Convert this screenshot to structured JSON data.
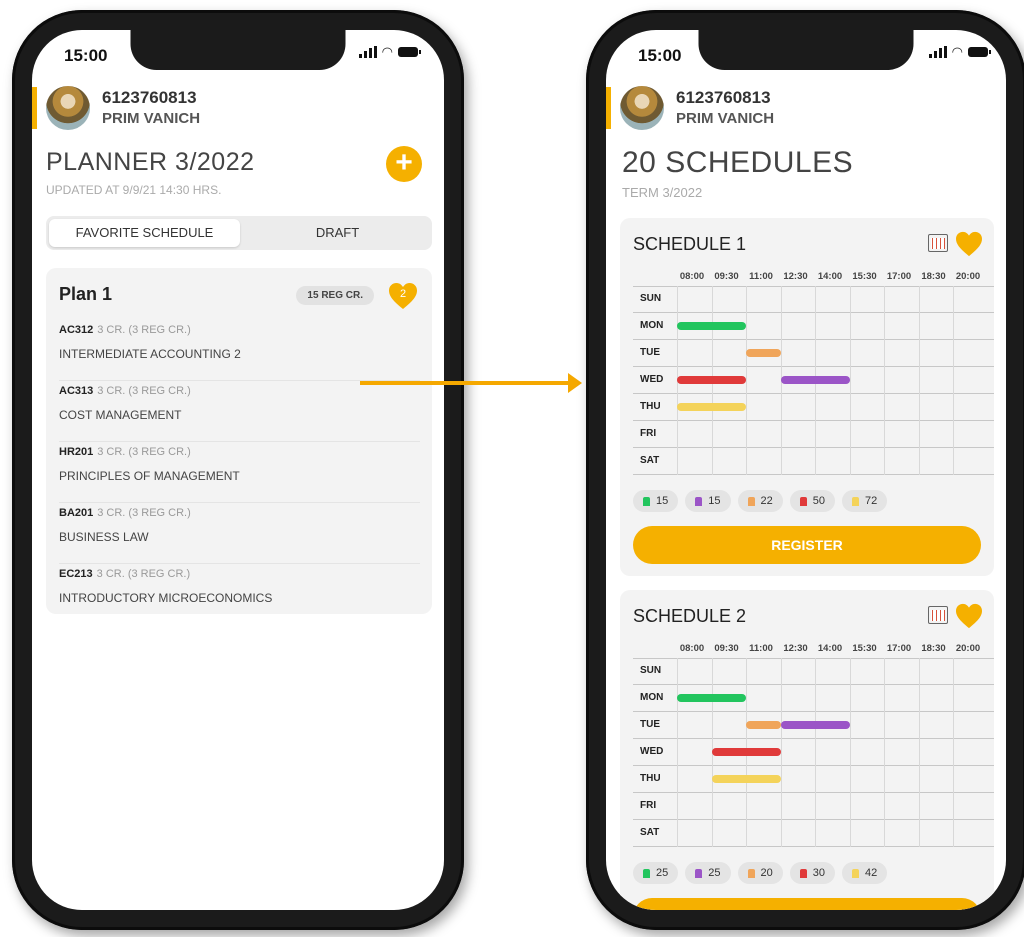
{
  "colors": {
    "accent": "#f5b000",
    "green": "#22c55e",
    "purple": "#9b55c7",
    "orange": "#f0a55a",
    "red": "#e03a3a",
    "yellow": "#f4d35a"
  },
  "left_phone": {
    "status": {
      "time": "15:00"
    },
    "profile": {
      "student_id": "6123760813",
      "name": "PRIM VANICH"
    },
    "title": "PLANNER 3/2022",
    "updated": "UPDATED AT 9/9/21 14:30 HRS.",
    "add_icon": "plus-icon",
    "tabs": {
      "favorite": "FAVORITE SCHEDULE",
      "draft": "DRAFT"
    },
    "plan": {
      "name": "Plan 1",
      "reg_credits": "15 REG CR.",
      "likes": "2",
      "courses": [
        {
          "code": "AC312",
          "credits": "3 CR. (3 REG CR.)",
          "name": "INTERMEDIATE ACCOUNTING 2"
        },
        {
          "code": "AC313",
          "credits": "3 CR. (3 REG CR.)",
          "name": "COST MANAGEMENT"
        },
        {
          "code": "HR201",
          "credits": "3 CR. (3 REG CR.)",
          "name": "PRINCIPLES OF MANAGEMENT"
        },
        {
          "code": "BA201",
          "credits": "3 CR. (3 REG CR.)",
          "name": "BUSINESS LAW"
        },
        {
          "code": "EC213",
          "credits": "3 CR. (3 REG CR.)",
          "name": "INTRODUCTORY MICROECONOMICS"
        }
      ]
    }
  },
  "right_phone": {
    "status": {
      "time": "15:00"
    },
    "profile": {
      "student_id": "6123760813",
      "name": "PRIM VANICH"
    },
    "title": "20 SCHEDULES",
    "term": "TERM 3/2022",
    "times": [
      "08:00",
      "09:30",
      "11:00",
      "12:30",
      "14:00",
      "15:30",
      "17:00",
      "18:30",
      "20:00"
    ],
    "days": [
      "SUN",
      "MON",
      "TUE",
      "WED",
      "THU",
      "FRI",
      "SAT"
    ],
    "schedules": [
      {
        "title": "SCHEDULE 1",
        "events": [
          {
            "day": "MON",
            "start": "08:00",
            "end": "11:00",
            "color": "#22c55e"
          },
          {
            "day": "TUE",
            "start": "11:00",
            "end": "12:30",
            "color": "#f0a55a"
          },
          {
            "day": "WED",
            "start": "08:00",
            "end": "11:00",
            "color": "#e03a3a"
          },
          {
            "day": "WED",
            "start": "12:30",
            "end": "15:30",
            "color": "#9b55c7"
          },
          {
            "day": "THU",
            "start": "08:00",
            "end": "11:00",
            "color": "#f4d35a"
          }
        ],
        "seats": [
          {
            "value": "15",
            "color": "#22c55e"
          },
          {
            "value": "15",
            "color": "#9b55c7"
          },
          {
            "value": "22",
            "color": "#f0a55a"
          },
          {
            "value": "50",
            "color": "#e03a3a"
          },
          {
            "value": "72",
            "color": "#f4d35a"
          }
        ],
        "register_label": "REGISTER"
      },
      {
        "title": "SCHEDULE 2",
        "events": [
          {
            "day": "MON",
            "start": "08:00",
            "end": "11:00",
            "color": "#22c55e"
          },
          {
            "day": "TUE",
            "start": "11:00",
            "end": "12:30",
            "color": "#f0a55a"
          },
          {
            "day": "TUE",
            "start": "12:30",
            "end": "15:30",
            "color": "#9b55c7"
          },
          {
            "day": "WED",
            "start": "09:30",
            "end": "12:30",
            "color": "#e03a3a"
          },
          {
            "day": "THU",
            "start": "09:30",
            "end": "12:30",
            "color": "#f4d35a"
          }
        ],
        "seats": [
          {
            "value": "25",
            "color": "#22c55e"
          },
          {
            "value": "25",
            "color": "#9b55c7"
          },
          {
            "value": "20",
            "color": "#f0a55a"
          },
          {
            "value": "30",
            "color": "#e03a3a"
          },
          {
            "value": "42",
            "color": "#f4d35a"
          }
        ],
        "register_label": ""
      }
    ]
  }
}
